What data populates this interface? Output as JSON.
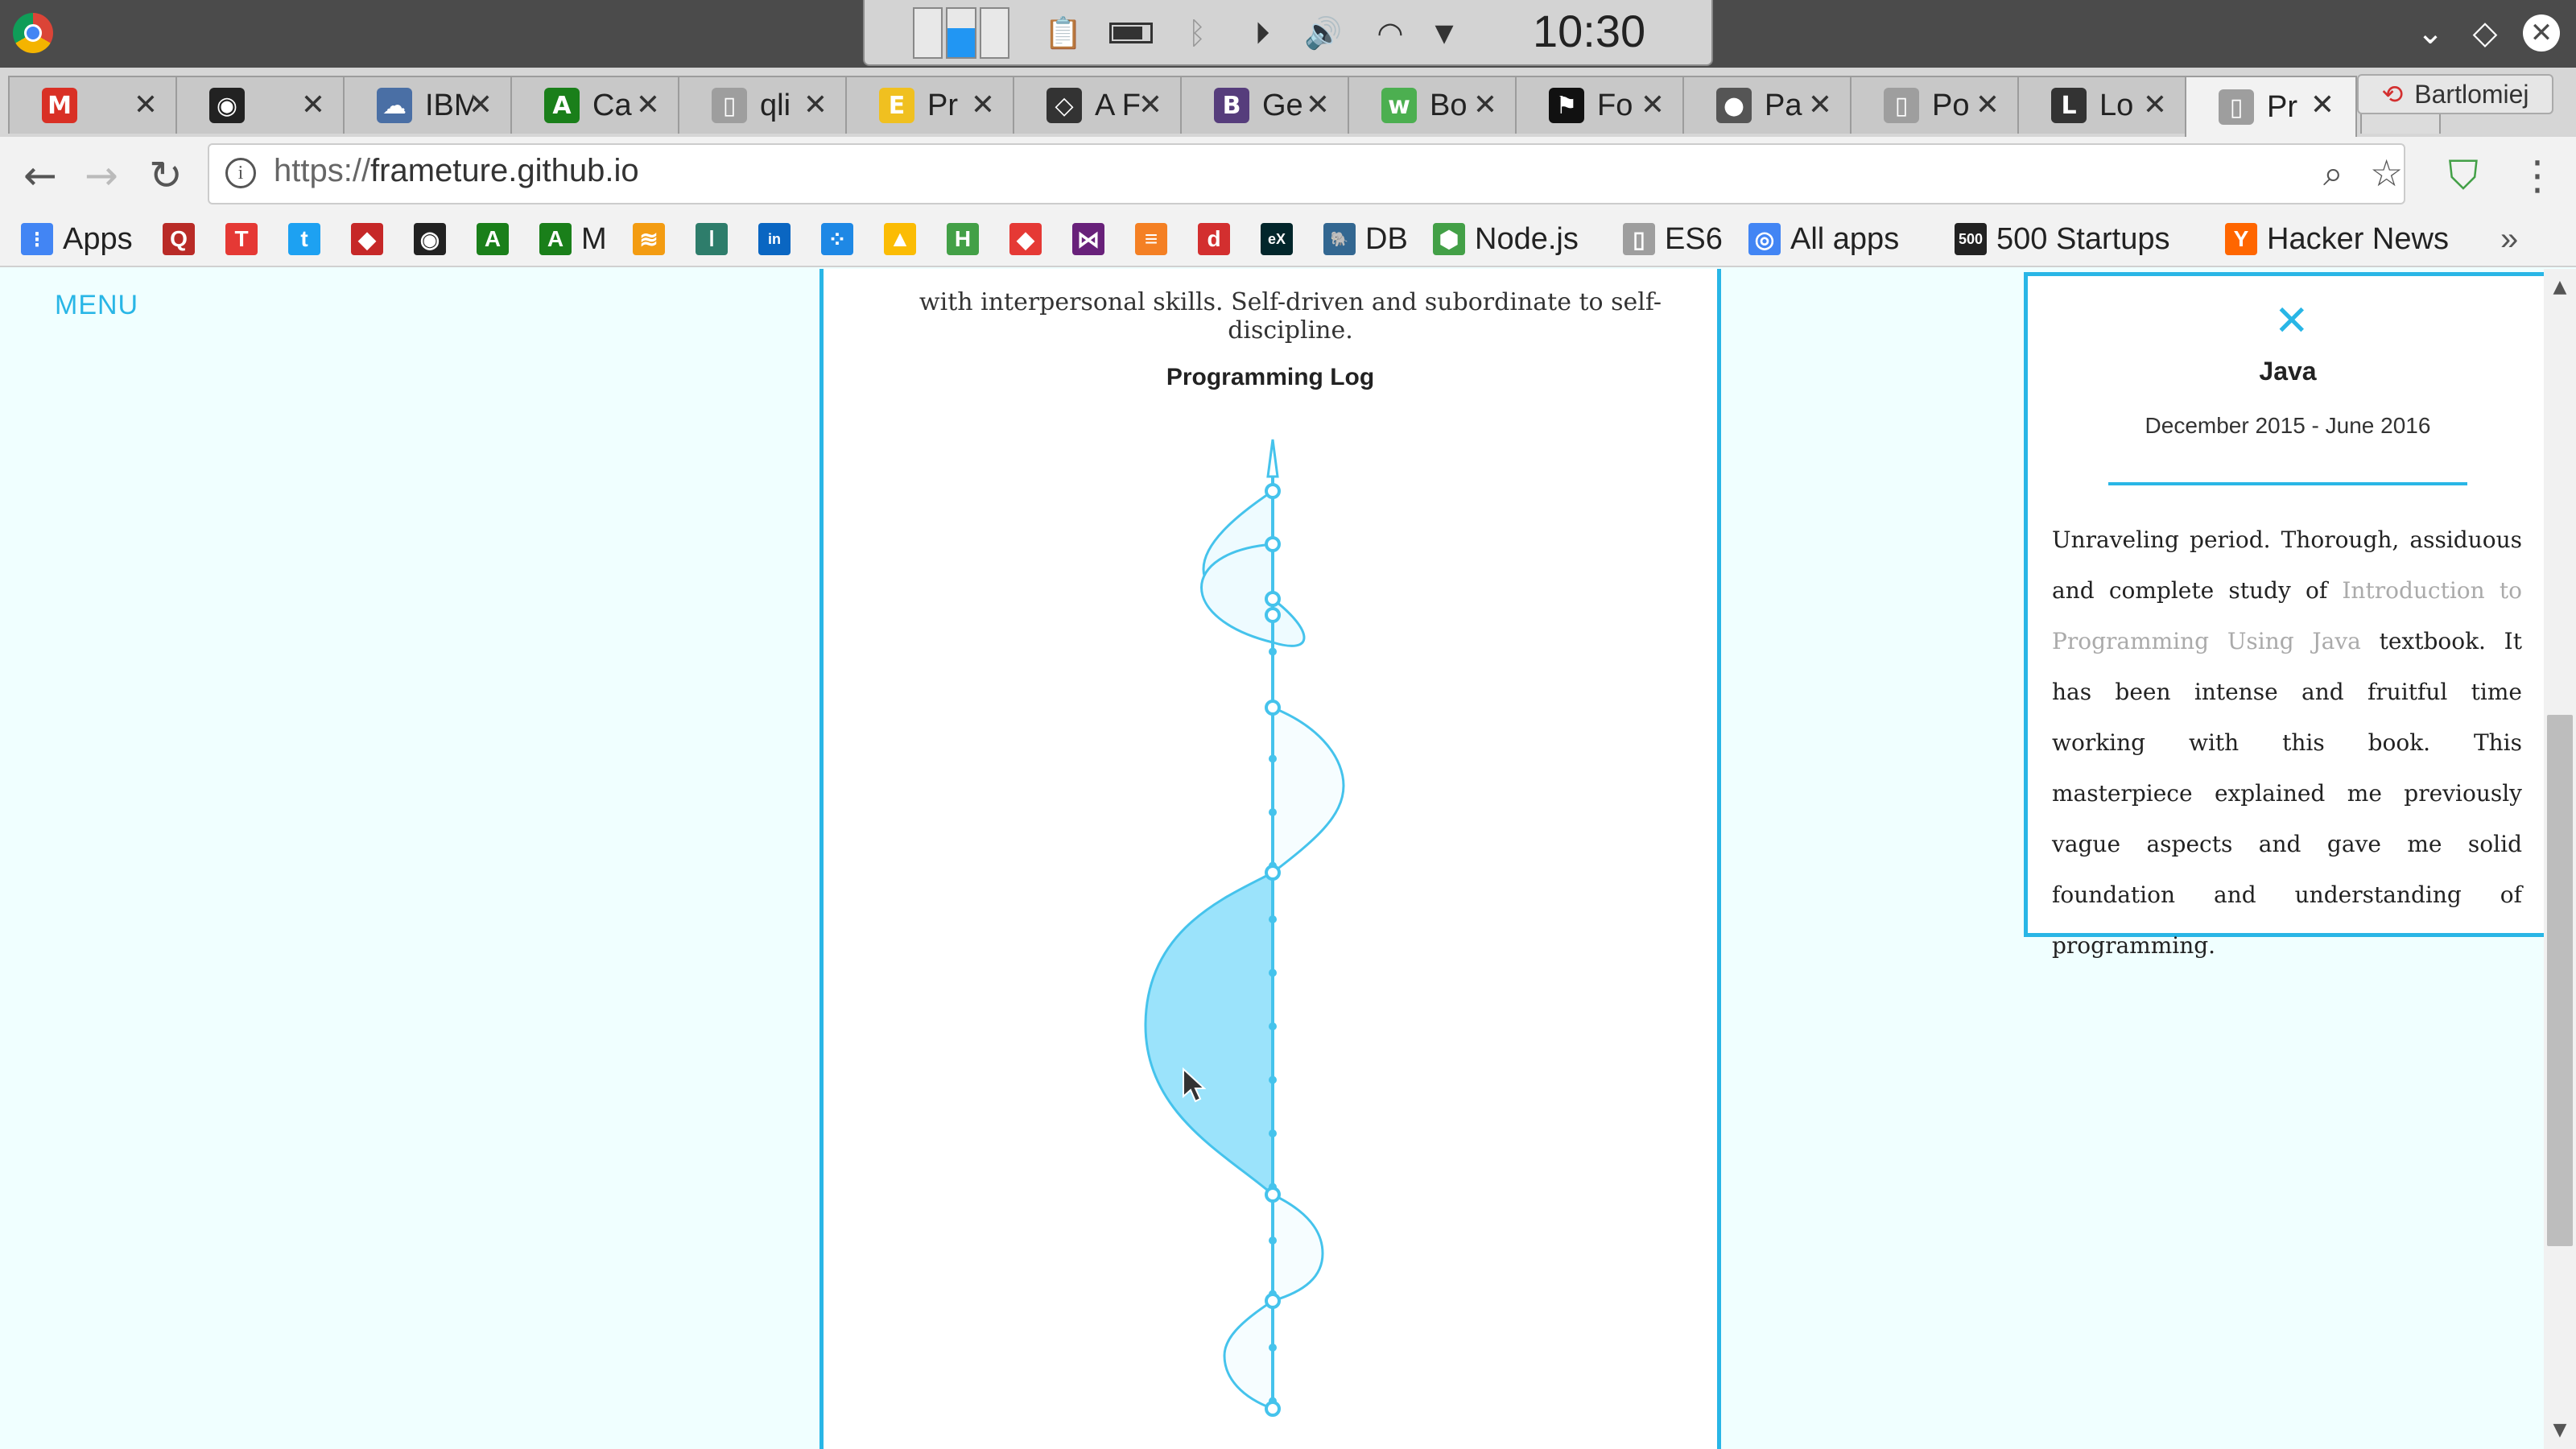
{
  "system": {
    "clock": "10:30"
  },
  "tabs": [
    {
      "icon": "gmail-icon",
      "title": "",
      "color": "#d93025",
      "glyph": "M"
    },
    {
      "icon": "github-icon",
      "title": "",
      "color": "#222222",
      "glyph": "◉"
    },
    {
      "icon": "cloud-icon",
      "title": "IBM",
      "color": "#4a6fa5",
      "glyph": "☁"
    },
    {
      "icon": "android-icon",
      "title": "Ca",
      "color": "#1a7f1a",
      "glyph": "A"
    },
    {
      "icon": "document-icon",
      "title": "qli",
      "color": "#9e9e9e",
      "glyph": "▯"
    },
    {
      "icon": "ejs-icon",
      "title": "Pr",
      "color": "#f0c020",
      "glyph": "E"
    },
    {
      "icon": "codepen-icon",
      "title": "A F",
      "color": "#333333",
      "glyph": "◇"
    },
    {
      "icon": "bootstrap-icon",
      "title": "Ge",
      "color": "#563d7c",
      "glyph": "B"
    },
    {
      "icon": "w3-icon",
      "title": "Bo",
      "color": "#4caf50",
      "glyph": "w"
    },
    {
      "icon": "flag-icon",
      "title": "Fo",
      "color": "#111111",
      "glyph": "⚑"
    },
    {
      "icon": "globe-icon",
      "title": "Pa",
      "color": "#555555",
      "glyph": "●"
    },
    {
      "icon": "document-icon",
      "title": "Po",
      "color": "#9e9e9e",
      "glyph": "▯"
    },
    {
      "icon": "l-icon",
      "title": "Lo",
      "color": "#333333",
      "glyph": "L"
    },
    {
      "icon": "document-icon",
      "title": "Pr",
      "color": "#9e9e9e",
      "glyph": "▯",
      "active": true
    }
  ],
  "profile": {
    "name": "Bartlomiej"
  },
  "address": {
    "scheme": "https://",
    "host": "frameture.github.io"
  },
  "bookmarks": [
    {
      "label": "Apps",
      "icon": "apps-grid-icon",
      "color": "#4285f4",
      "glyph": "⁝"
    },
    {
      "label": "",
      "icon": "quora-icon",
      "color": "#b92b27",
      "glyph": "Q"
    },
    {
      "label": "",
      "icon": "t-icon",
      "color": "#e53935",
      "glyph": "T"
    },
    {
      "label": "",
      "icon": "twitter-icon",
      "color": "#1da1f2",
      "glyph": "t"
    },
    {
      "label": "",
      "icon": "ruby-icon",
      "color": "#c62828",
      "glyph": "◆"
    },
    {
      "label": "",
      "icon": "github-icon",
      "color": "#222222",
      "glyph": "◉"
    },
    {
      "label": "",
      "icon": "android-icon",
      "color": "#1a7f1a",
      "glyph": "A"
    },
    {
      "label": "M",
      "icon": "android-icon",
      "color": "#1a7f1a",
      "glyph": "A"
    },
    {
      "label": "",
      "icon": "layers-icon",
      "color": "#f39c12",
      "glyph": "≋"
    },
    {
      "label": "",
      "icon": "bars-icon",
      "color": "#2e7d6b",
      "glyph": "ǀ"
    },
    {
      "label": "",
      "icon": "linkedin-icon",
      "color": "#0a66c2",
      "glyph": "in"
    },
    {
      "label": "",
      "icon": "dots-icon",
      "color": "#1e88e5",
      "glyph": "⁘"
    },
    {
      "label": "",
      "icon": "drive-icon",
      "color": "#fbbc04",
      "glyph": "▲"
    },
    {
      "label": "",
      "icon": "h-icon",
      "color": "#43a047",
      "glyph": "H"
    },
    {
      "label": "",
      "icon": "gem-icon",
      "color": "#e53935",
      "glyph": "◆"
    },
    {
      "label": "",
      "icon": "visualstudio-icon",
      "color": "#68217a",
      "glyph": "⋈"
    },
    {
      "label": "",
      "icon": "stackoverflow-icon",
      "color": "#f48024",
      "glyph": "≡"
    },
    {
      "label": "",
      "icon": "diki-icon",
      "color": "#d32f2f",
      "glyph": "d"
    },
    {
      "label": "",
      "icon": "edx-icon",
      "color": "#02262b",
      "glyph": "eX"
    },
    {
      "label": "DB",
      "icon": "postgres-icon",
      "color": "#336791",
      "glyph": "🐘"
    },
    {
      "label": "Node.js",
      "icon": "nodejs-icon",
      "color": "#43a047",
      "glyph": "⬢"
    },
    {
      "label": "ES6",
      "icon": "document-icon",
      "color": "#9e9e9e",
      "glyph": "▯"
    },
    {
      "label": "All apps",
      "icon": "chrome-apps-icon",
      "color": "#4285f4",
      "glyph": "◎"
    },
    {
      "label": "500 Startups",
      "icon": "500-icon",
      "color": "#222222",
      "glyph": "500"
    },
    {
      "label": "Hacker News",
      "icon": "hackernews-icon",
      "color": "#ff6600",
      "glyph": "Y"
    }
  ],
  "page": {
    "menu_label": "MENU",
    "intro_text": "with interpersonal skills. Self-driven and subordinate to self-discipline.",
    "log_title": "Programming Log"
  },
  "detail": {
    "title": "Java",
    "dates": "December 2015 - June 2016",
    "body_before": "Unraveling period. Thorough, assiduous and complete study of ",
    "body_link": "Introduction to Programming Using Java",
    "body_after": " textbook. It has been intense and fruitful time working with this book. This masterpiece explained me previously vague aspects and gave me solid foundation and understanding of programming."
  },
  "colors": {
    "accent": "#29b6e6",
    "wave_stroke": "#45c3ec",
    "wave_fill_active": "#9be3fb",
    "wave_fill_light": "#eefbff",
    "page_bg": "#f0ffff"
  }
}
